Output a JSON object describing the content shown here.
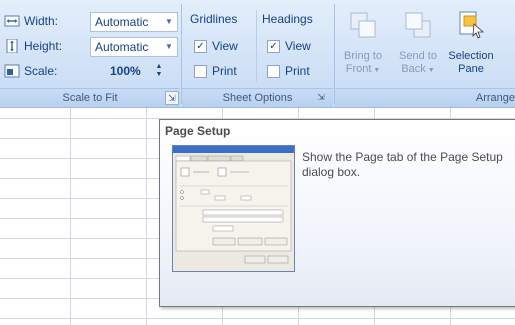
{
  "ribbon": {
    "scale_to_fit": {
      "label": "Scale to Fit",
      "width": {
        "label": "Width:",
        "value": "Automatic"
      },
      "height": {
        "label": "Height:",
        "value": "Automatic"
      },
      "scale": {
        "label": "Scale:",
        "value": "100%"
      }
    },
    "sheet_options": {
      "label": "Sheet Options",
      "gridlines": {
        "header": "Gridlines",
        "view": "View",
        "print": "Print",
        "view_checked": true,
        "print_checked": false
      },
      "headings": {
        "header": "Headings",
        "view": "View",
        "print": "Print",
        "view_checked": true,
        "print_checked": false
      }
    },
    "arrange": {
      "label": "Arrange",
      "bring_to_front": {
        "line1": "Bring to",
        "line2": "Front"
      },
      "send_to_back": {
        "line1": "Send to",
        "line2": "Back"
      },
      "selection_pane": {
        "line1": "Selection",
        "line2": "Pane"
      }
    }
  },
  "tooltip": {
    "title": "Page Setup",
    "body": "Show the Page tab of the Page Setup dialog box."
  },
  "colors": {
    "ribbon_bg": "#d3e3f7",
    "ribbon_text": "#15428b",
    "grid": "#d0d7e5"
  }
}
